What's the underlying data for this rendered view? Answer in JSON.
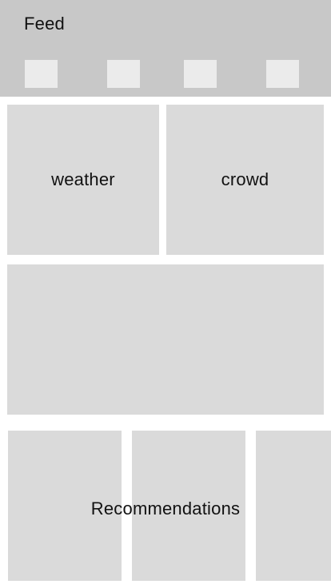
{
  "header": {
    "title": "Feed",
    "tabs": [
      {
        "label": ""
      },
      {
        "label": ""
      },
      {
        "label": ""
      },
      {
        "label": ""
      }
    ]
  },
  "cards": {
    "weather": "weather",
    "crowd": "crowd",
    "featured": ""
  },
  "recommendations": {
    "label": "Recommendations",
    "items": [
      {
        "label": ""
      },
      {
        "label": ""
      },
      {
        "label": ""
      }
    ]
  },
  "colors": {
    "header_bg": "#c8c8c8",
    "tile_bg": "#ebebeb",
    "card_bg": "#dadada",
    "page_bg": "#ffffff",
    "text": "#111111"
  }
}
